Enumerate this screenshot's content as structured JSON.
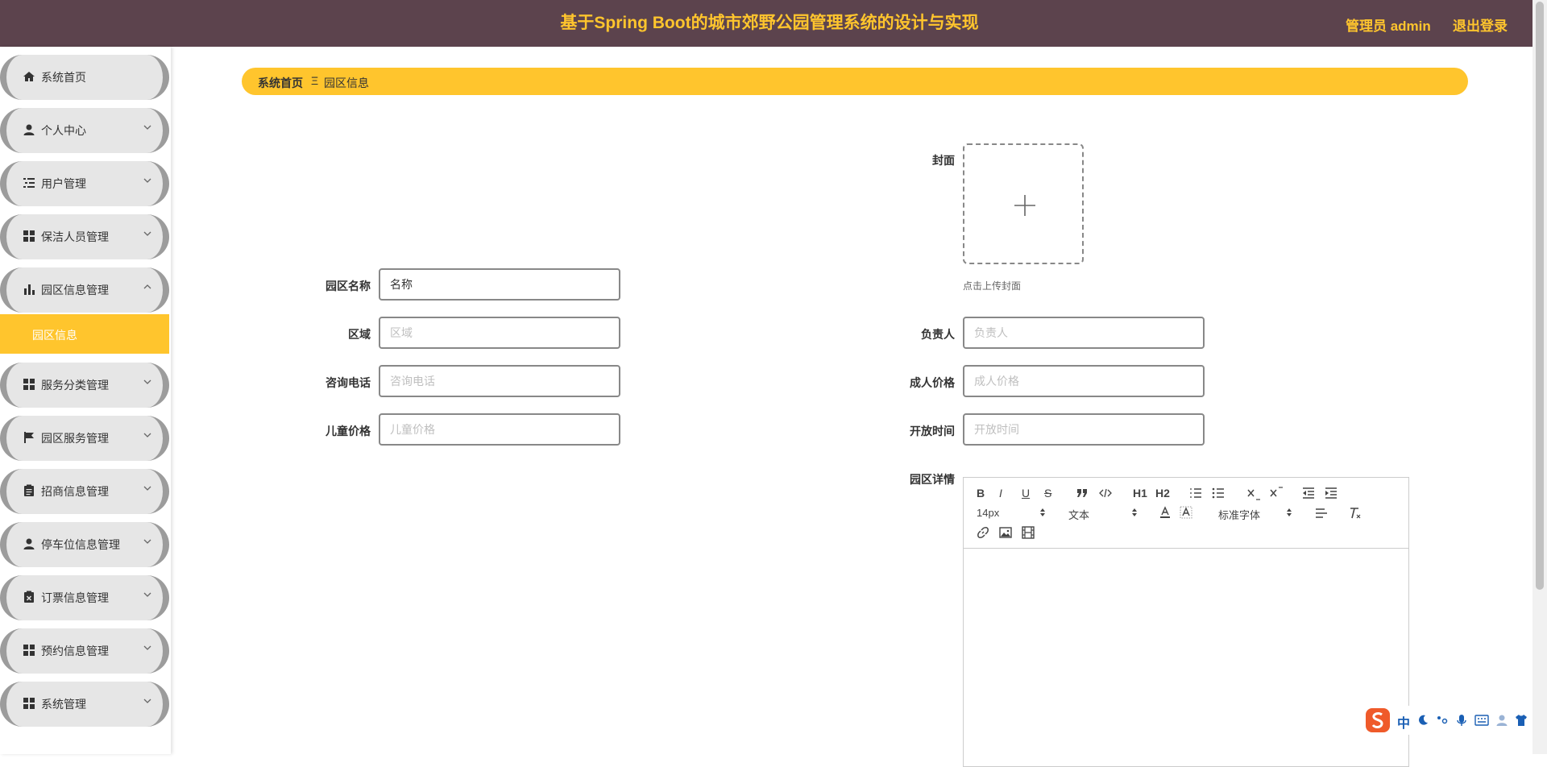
{
  "header": {
    "title": "基于Spring Boot的城市郊野公园管理系统的设计与实现",
    "user": "管理员 admin",
    "logout": "退出登录"
  },
  "sidebar": {
    "items": [
      {
        "label": "系统首页",
        "icon": "home-icon"
      },
      {
        "label": "个人中心",
        "icon": "person-icon"
      },
      {
        "label": "用户管理",
        "icon": "list-icon"
      },
      {
        "label": "保洁人员管理",
        "icon": "grid-icon"
      },
      {
        "label": "园区信息管理",
        "icon": "bar-chart-icon"
      },
      {
        "label": "服务分类管理",
        "icon": "grid-icon"
      },
      {
        "label": "园区服务管理",
        "icon": "flag-icon"
      },
      {
        "label": "招商信息管理",
        "icon": "clipboard-icon"
      },
      {
        "label": "停车位信息管理",
        "icon": "person-icon"
      },
      {
        "label": "订票信息管理",
        "icon": "clipboard-x-icon"
      },
      {
        "label": "预约信息管理",
        "icon": "grid-icon"
      },
      {
        "label": "系统管理",
        "icon": "grid-icon"
      }
    ],
    "active_sub": "园区信息"
  },
  "breadcrumb": {
    "home": "系统首页",
    "separator": "Ξ",
    "current": "园区信息"
  },
  "form": {
    "cover_label": "封面",
    "cover_tip": "点击上传封面",
    "name_label": "园区名称",
    "name_value": "名称",
    "area_label": "区域",
    "area_placeholder": "区域",
    "manager_label": "负责人",
    "manager_placeholder": "负责人",
    "phone_label": "咨询电话",
    "phone_placeholder": "咨询电话",
    "adult_price_label": "成人价格",
    "adult_price_placeholder": "成人价格",
    "child_price_label": "儿童价格",
    "child_price_placeholder": "儿童价格",
    "open_time_label": "开放时间",
    "open_time_placeholder": "开放时间",
    "detail_label": "园区详情"
  },
  "editor": {
    "font_size": "14px",
    "header_select": "文本",
    "font_family": "标准字体",
    "bold": "B",
    "italic": "I",
    "underline": "U",
    "strike": "S",
    "h1": "H1",
    "h2": "H2"
  },
  "ime": {
    "lang": "中"
  },
  "colors": {
    "header_bg": "#5c434d",
    "accent": "#ffc52d"
  }
}
